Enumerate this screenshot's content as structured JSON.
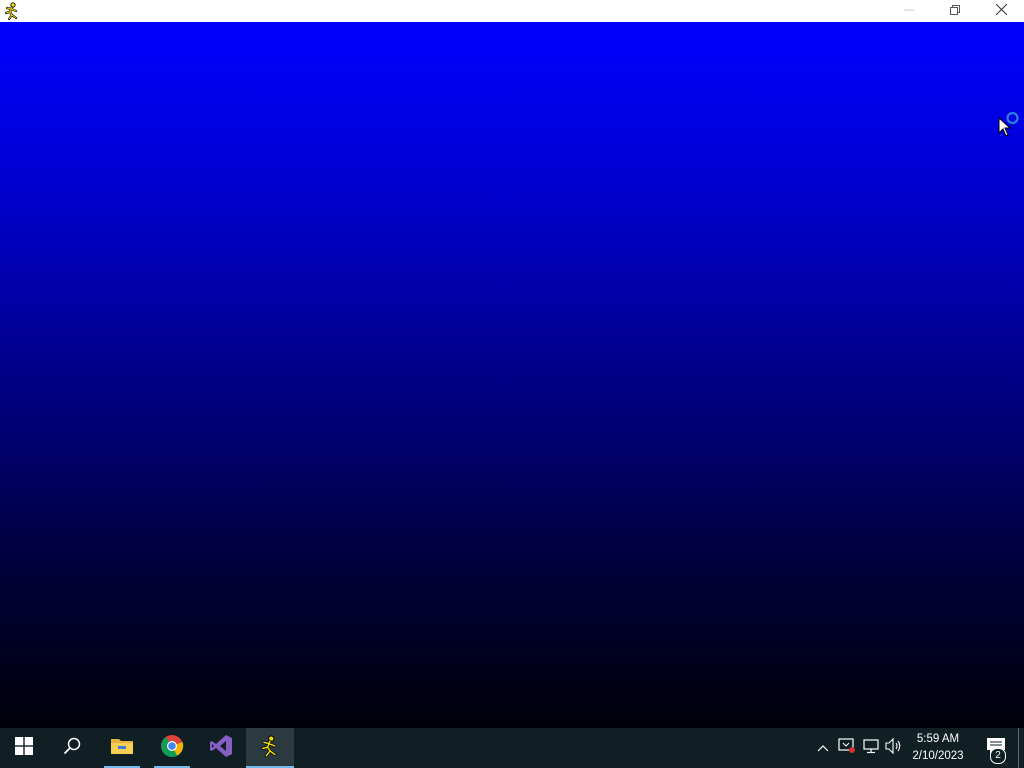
{
  "window": {
    "app_icon": "running-man-icon",
    "controls": [
      "minimize-icon",
      "restore-icon",
      "close-icon"
    ],
    "background_colors": [
      "#0000ff",
      "#00000a"
    ]
  },
  "taskbar": {
    "apps": [
      {
        "name": "start",
        "icon": "windows-logo-icon"
      },
      {
        "name": "search",
        "icon": "search-icon"
      },
      {
        "name": "file-explorer",
        "icon": "folder-icon",
        "running": true
      },
      {
        "name": "chrome",
        "icon": "chrome-icon",
        "running": true
      },
      {
        "name": "visual-studio",
        "icon": "visual-studio-icon"
      },
      {
        "name": "aim",
        "icon": "running-man-icon",
        "active": true
      }
    ],
    "tray": {
      "icons": [
        "chevron-up-icon",
        "security-alert-icon",
        "network-icon",
        "volume-icon"
      ],
      "time": "5:59 AM",
      "date": "2/10/2023",
      "notification_count": "2"
    },
    "accent": "#76b9ed"
  }
}
